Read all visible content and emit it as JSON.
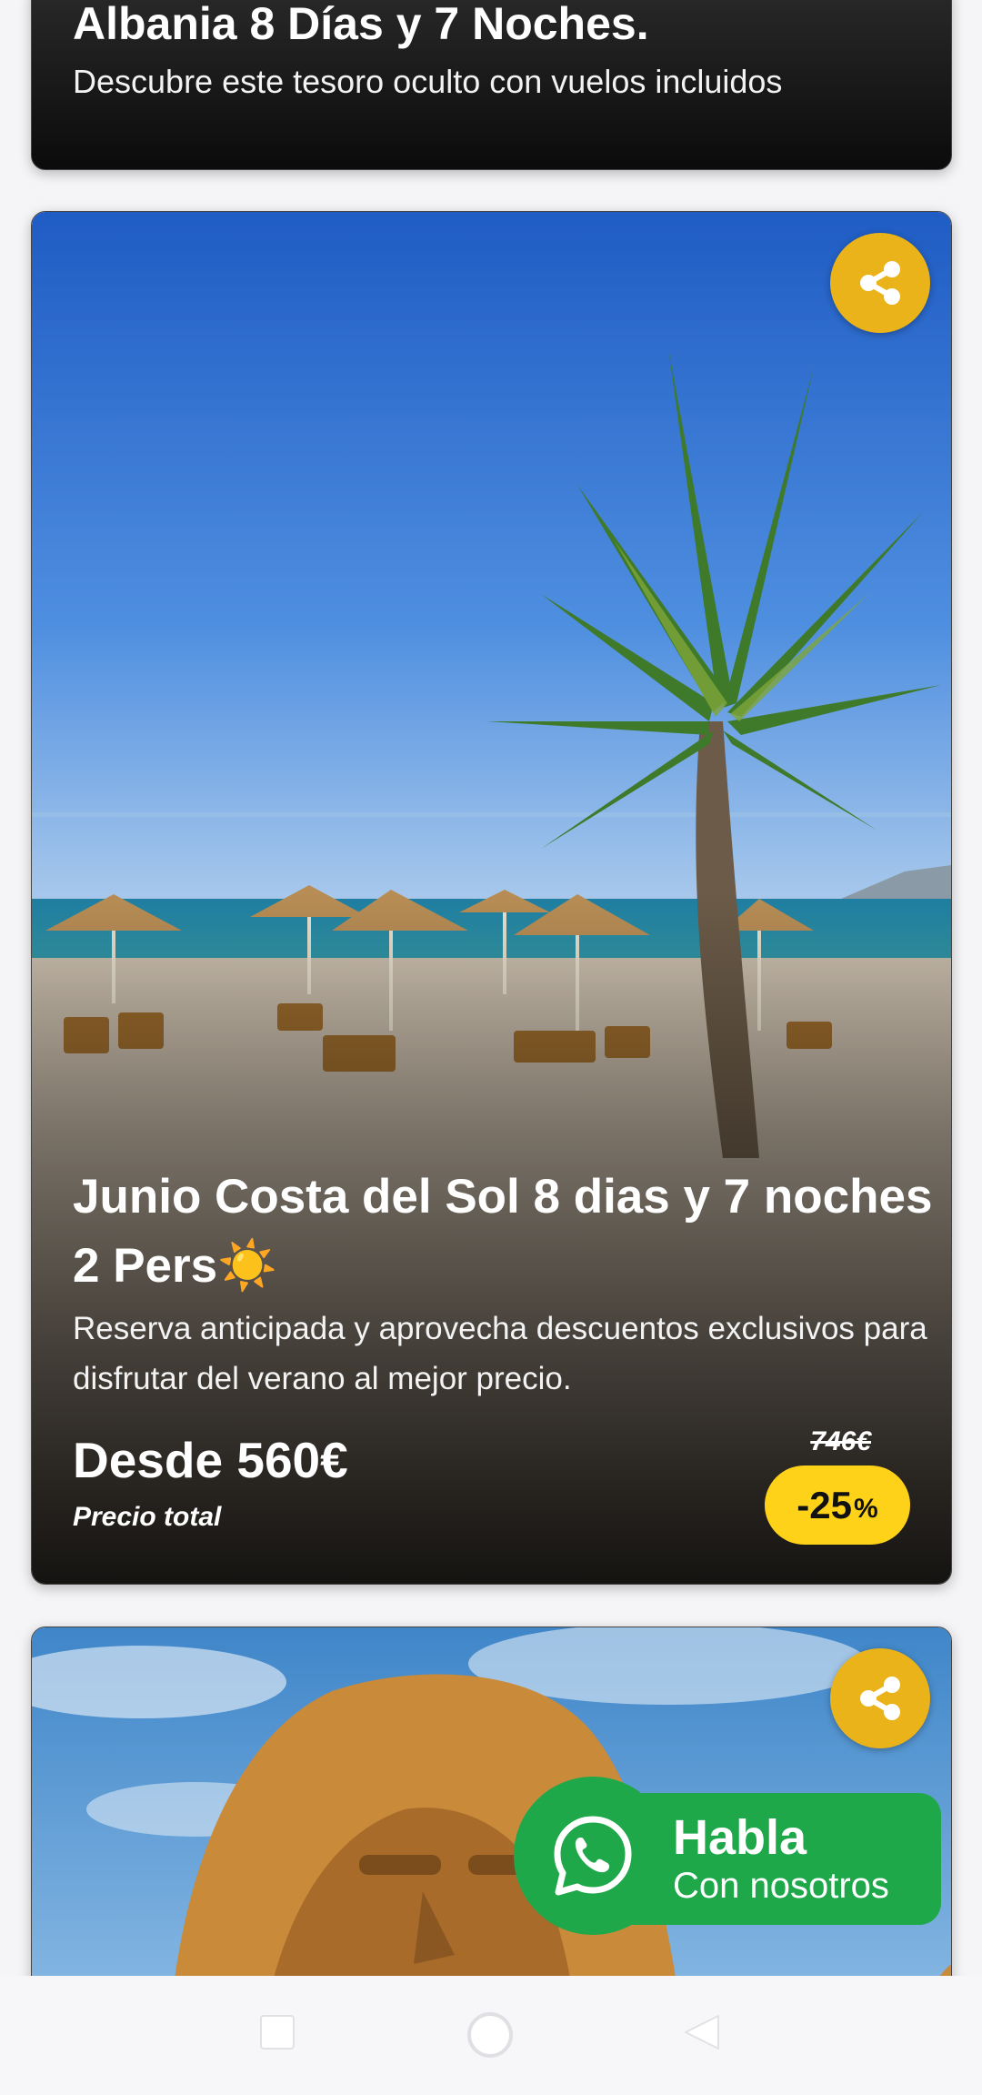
{
  "cards": [
    {
      "title": "Albania 8 Días y 7 Noches.",
      "subtitle": "Descubre este tesoro oculto con vuelos incluidos"
    },
    {
      "title": "Junio Costa del Sol 8 dias y 7 noches 2 Pers☀️",
      "description": "Reserva anticipada y aprovecha descuentos exclusivos para disfrutar del verano al mejor precio.",
      "price": "Desde 560€",
      "price_note": "Precio total",
      "old_price": "746€",
      "discount_value": "-25",
      "discount_unit": "%",
      "share_icon": "share-icon"
    },
    {
      "share_icon": "share-icon"
    }
  ],
  "whatsapp": {
    "title": "Habla",
    "subtitle": "Con nosotros",
    "icon": "whatsapp-icon",
    "color": "#1ea84a"
  },
  "navbar": {
    "buttons": [
      "recents-button",
      "home-button",
      "back-button"
    ]
  },
  "colors": {
    "share_button": "#eab31a",
    "discount_badge": "#ffd21a"
  }
}
